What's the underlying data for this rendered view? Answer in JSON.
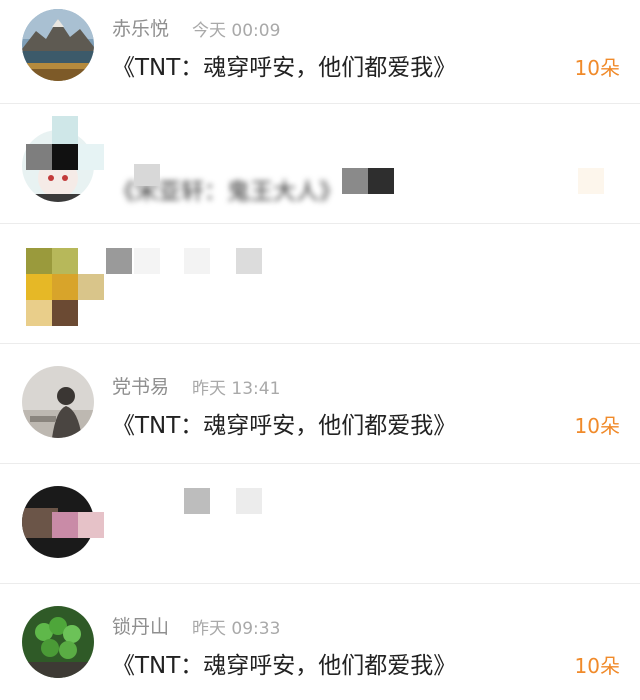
{
  "rows": [
    {
      "name": "赤乐悦",
      "time": "今天 00:09",
      "title": "《TNT：魂穿呼安，他们都爱我》",
      "count": "10朵",
      "avatar_icon": "mountain-lake-avatar"
    },
    {
      "name": "",
      "time": "",
      "title": "《宋亚轩：鬼王大人》",
      "count": "",
      "avatar_icon": "anime-avatar"
    },
    {
      "name": "",
      "time": "",
      "title": "",
      "count": "",
      "avatar_icon": "pixelated-avatar"
    },
    {
      "name": "党书易",
      "time": "昨天 13:41",
      "title": "《TNT：魂穿呼安，他们都爱我》",
      "count": "10朵",
      "avatar_icon": "person-avatar"
    },
    {
      "name": "",
      "time": "",
      "title": "",
      "count": "",
      "avatar_icon": "pixelated-avatar"
    },
    {
      "name": "锁丹山",
      "time": "昨天 09:33",
      "title": "《TNT：魂穿呼安，他们都爱我》",
      "count": "10朵",
      "avatar_icon": "clover-avatar"
    }
  ],
  "colors": {
    "accent": "#f08a2a",
    "name": "#8f8f8f",
    "time": "#a9a9a9",
    "title": "#222222",
    "divider": "#ececec"
  }
}
